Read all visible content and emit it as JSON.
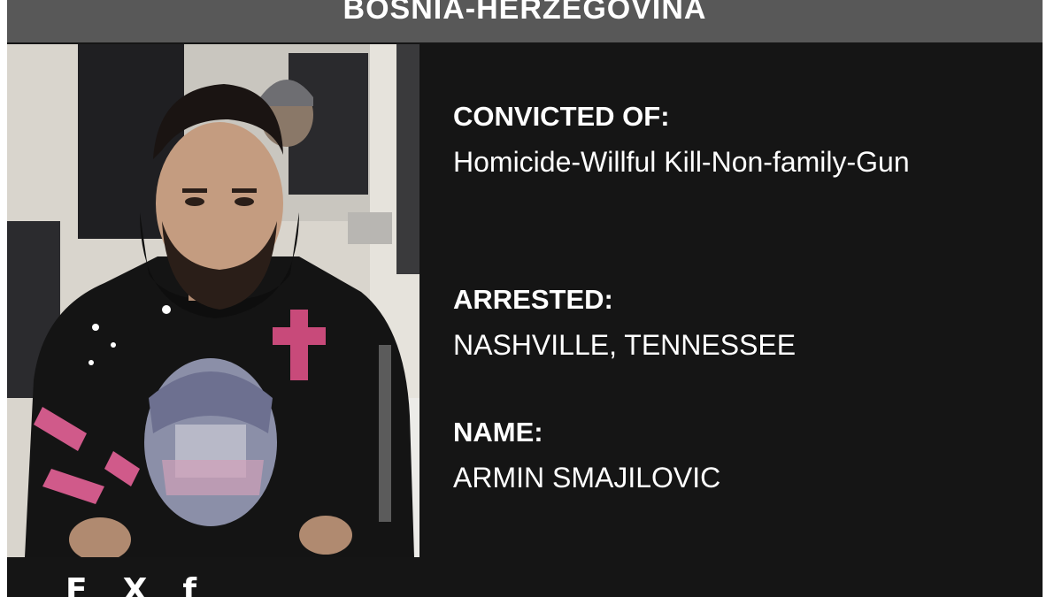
{
  "banner": {
    "country": "BOSNIA-HERZEGOVINA"
  },
  "photo": {
    "alt": "Photo of the person"
  },
  "details": {
    "convicted_label": "CONVICTED OF:",
    "convicted_value": "Homicide-Willful Kill-Non-family-Gun",
    "arrested_label": "ARRESTED:",
    "arrested_value": "NASHVILLE, TENNESSEE",
    "name_label": "NAME:",
    "name_value": "ARMIN SMAJILOVIC"
  },
  "share": {
    "icons": [
      "flipboard-icon",
      "x-icon",
      "facebook-icon"
    ],
    "glyphs": [
      "F",
      "X",
      "f"
    ]
  },
  "colors": {
    "card_bg": "#151515",
    "banner_bg": "#585858",
    "text": "#ffffff"
  }
}
